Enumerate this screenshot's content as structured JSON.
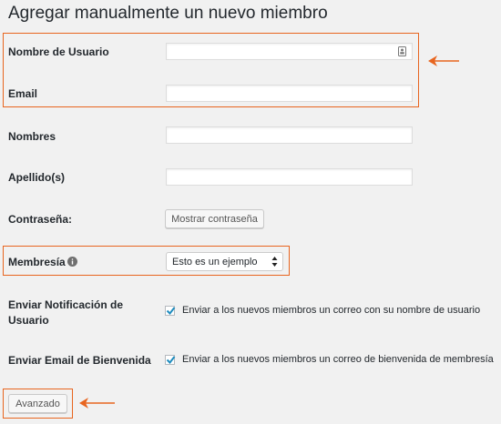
{
  "page": {
    "title": "Agregar manualmente un nuevo miembro"
  },
  "form": {
    "username": {
      "label": "Nombre de Usuario",
      "value": ""
    },
    "email": {
      "label": "Email",
      "value": ""
    },
    "first_name": {
      "label": "Nombres",
      "value": ""
    },
    "last_name": {
      "label": "Apellido(s)",
      "value": ""
    },
    "password": {
      "label": "Contraseña:",
      "button_label": "Mostrar contraseña"
    },
    "membership": {
      "label": "Membresía",
      "selected": "Esto es un ejemplo",
      "info_icon": "info-icon"
    },
    "notify_user": {
      "label_line1": "Enviar Notificación de",
      "label_line2": "Usuario",
      "checkbox_label": "Enviar a los nuevos miembros un correo con su nombre de usuario",
      "checked": true
    },
    "welcome_email": {
      "label": "Enviar Email de Bienvenida",
      "checkbox_label": "Enviar a los nuevos miembros un correo de bienvenida de membresía",
      "checked": true
    },
    "submit_label": "Avanzado"
  },
  "annotations": {
    "color": "#e8651f"
  }
}
